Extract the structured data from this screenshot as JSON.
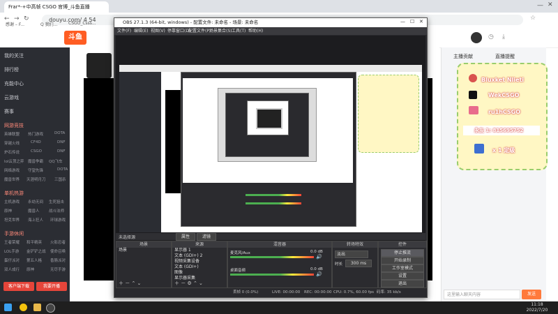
{
  "browser": {
    "tab_title": "Frar*-+中高帧 CSGO 官博_斗鱼直播",
    "url": "douyu.com/ 4 54",
    "bookmarks": [
      "感谢 – F...",
      "Q 我们...",
      "CSGO_Csss..."
    ]
  },
  "douyu": {
    "logo": "斗鱼",
    "sidebar": {
      "items": [
        "我的关注",
        "排行榜",
        "充能中心",
        "云游戏",
        "赛事"
      ],
      "section_online": "网游竞技",
      "online_games": [
        "英雄联盟",
        "热门游戏",
        "DOTA",
        "穿越火线",
        "CF4D",
        "DNF",
        "炉石传说",
        "CSGO",
        "DNF",
        "lol云顶之弈",
        "魔兽争霸",
        "QQ飞车",
        "网络游戏",
        "守望先锋",
        "DOTA",
        "魔兽世界",
        "天涯明月刀",
        "三国杀"
      ],
      "section_mobile": "单机热游",
      "mobile_games": [
        "主机游戏",
        "永劫无间",
        "生死狙击",
        "原神",
        "魔兽人",
        "战斗法师",
        "坦克世界",
        "海上狂人",
        "环球游戏"
      ],
      "section_phone": "手游休闲",
      "phone_games": [
        "王者荣耀",
        "和平精英",
        "火影忍者",
        "LOL手游",
        "金铲铲之战",
        "使命召唤",
        "蛋仔派对",
        "第五人格",
        "香肠派对",
        "双人成行",
        "原神",
        "无尽手游"
      ],
      "btn_left": "客户端下载",
      "btn_right": "我要开播"
    },
    "right_panel": {
      "tab1": "主播贡献",
      "tab2": "直播提醒",
      "overlay_line1": "Bluxket Nlieti",
      "overlay_line2": "WekCSGO",
      "overlay_line3": "ru1hCSGO",
      "overlay_line4": "永友 1: 815695752",
      "overlay_line5": "x 1 定级",
      "chat_placeholder": "这里输入聊天内容",
      "send_label": "发送"
    }
  },
  "obs": {
    "title": "OBS 27.1.3 (64-bit, windows) - 配置文件: 未命名 - 场景: 未命名",
    "menu": [
      "文件(F)",
      "编辑(E)",
      "视图(V)",
      "停靠窗口(D)",
      "配置文件(P)",
      "场景集合(S)",
      "工具(T)",
      "帮助(H)"
    ],
    "preview_title": "未选择源",
    "prop_btn": "属性",
    "filter_btn": "滤镜",
    "docks": {
      "scenes": "场景",
      "sources": "来源",
      "mixer": "混音器",
      "transitions": "转场特效",
      "controls": "控件"
    },
    "scene_items": [
      "场景"
    ],
    "source_items": [
      "显示器 1",
      "文本 (GDI+) 2",
      "视频采集设备",
      "文本 (GDI+)",
      "图像",
      "显示器采集"
    ],
    "mixer_tracks": [
      {
        "name": "麦克风/Aux",
        "db": "0.0 dB"
      },
      {
        "name": "桌面音频",
        "db": "0.0 dB"
      }
    ],
    "transition": {
      "type": "淡出",
      "duration_label": "时长",
      "duration": "300 ms"
    },
    "controls": [
      "停止推流",
      "开始录制",
      "工作室模式",
      "设置",
      "退出"
    ],
    "status": {
      "dropped": "丢帧 0 (0.0%)",
      "live": "LIVE: 00:00:00",
      "rec": "REC: 00:00:00",
      "cpu": "CPU: 0.7%, 60.00 fps",
      "kbps": "码率: 35 kb/s"
    }
  },
  "taskbar": {
    "time": "11:18",
    "date": "2022/7/20"
  },
  "colors": {
    "douyu_orange": "#ff5d23",
    "sidebar_bg": "#2b2d33",
    "obs_bg": "#2a2a2e",
    "overlay_card": "#fff7c4"
  }
}
